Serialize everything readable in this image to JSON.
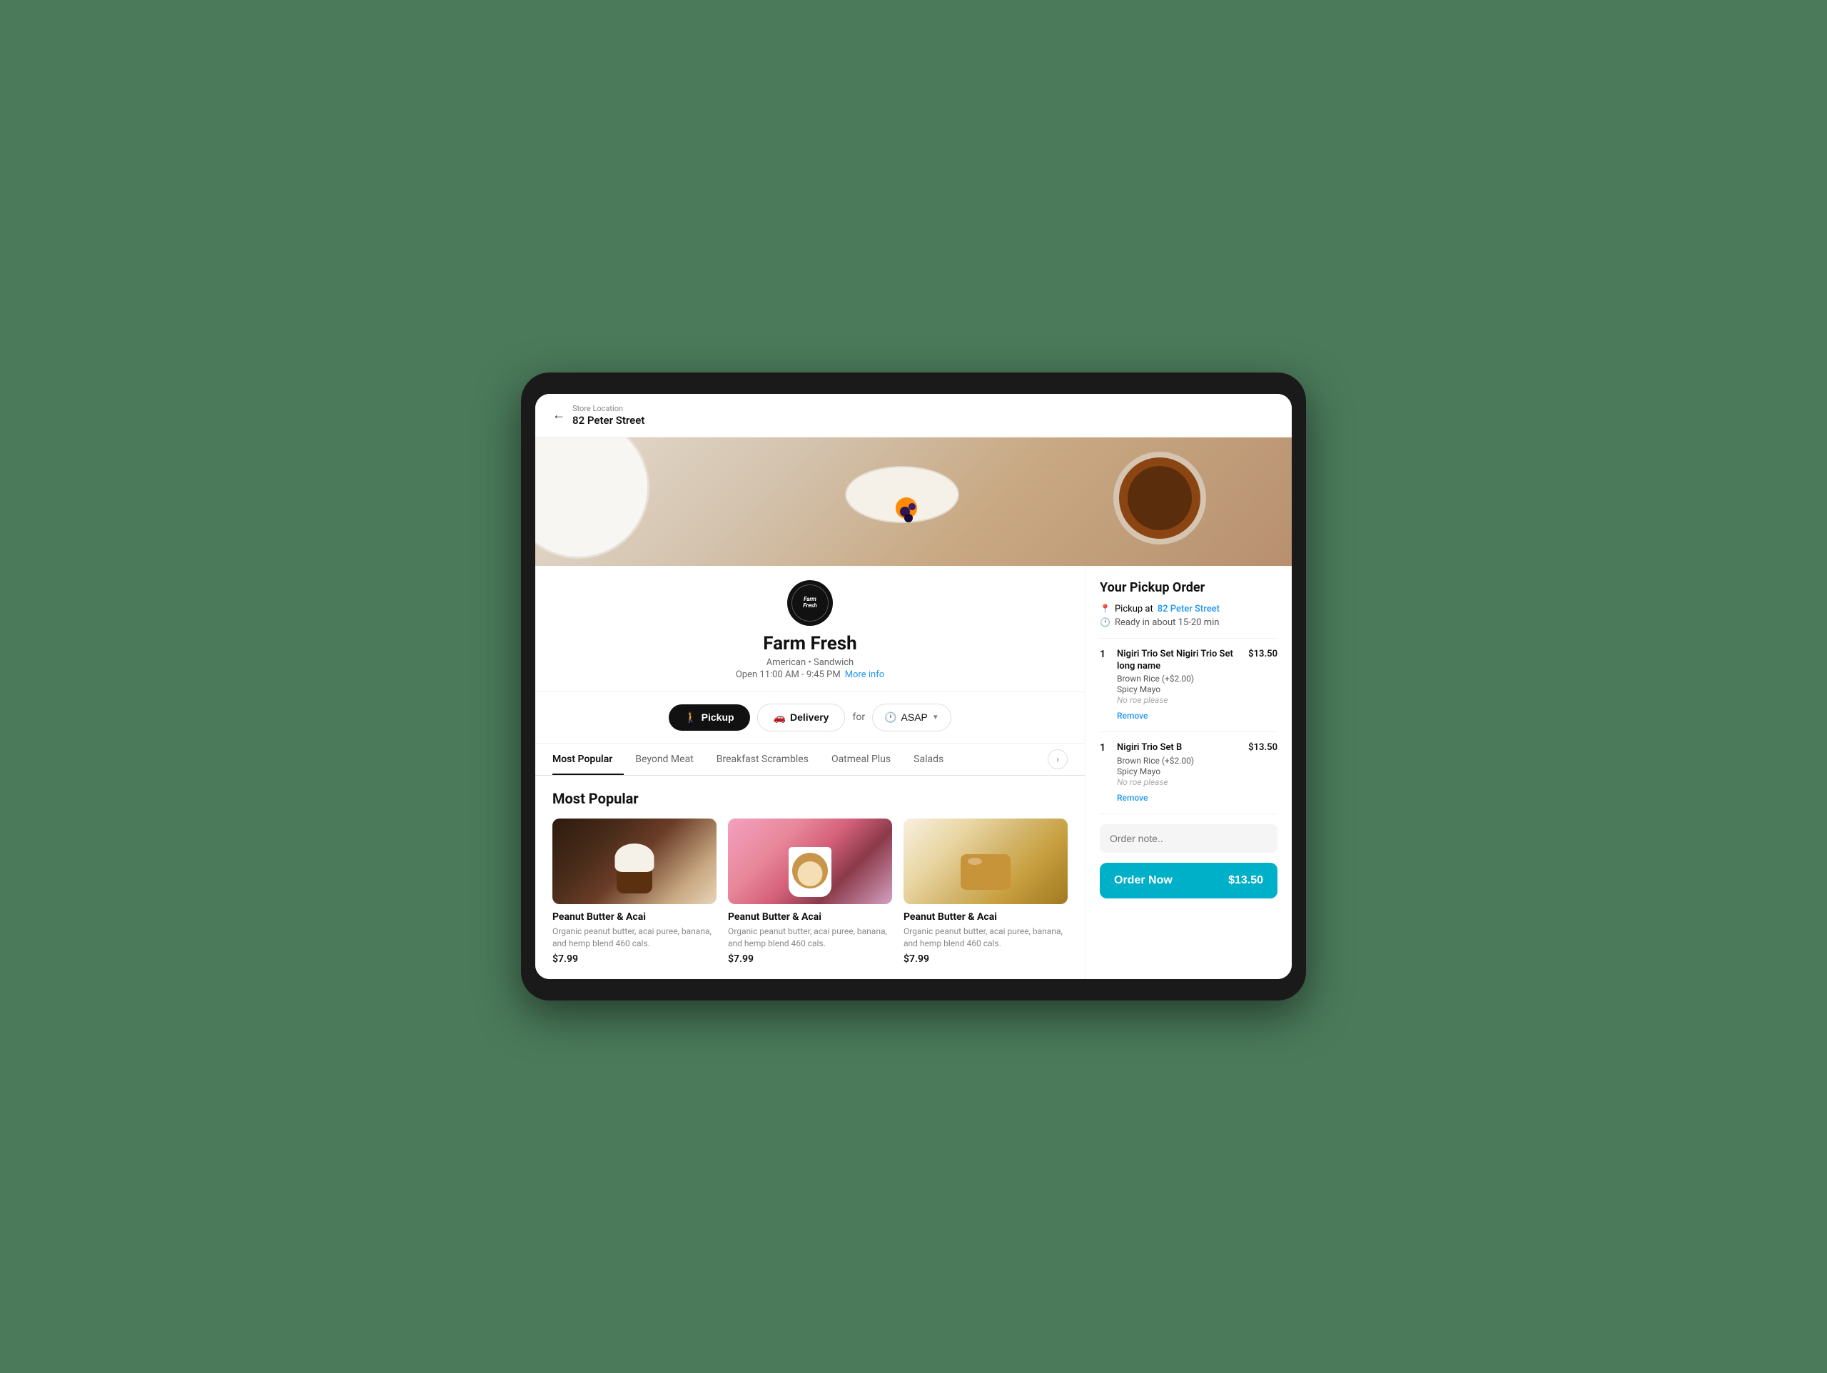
{
  "tablet": {
    "top_bar": {
      "back_label": "←",
      "store_location_label": "Store Location",
      "store_location_name": "82 Peter Street"
    },
    "restaurant": {
      "name": "Farm Fresh",
      "cuisine": "American • Sandwich",
      "hours": "Open 11:00 AM - 9:45 PM",
      "more_info": "More info",
      "logo_text": "Farm\nFresh"
    },
    "actions": {
      "pickup_label": "Pickup",
      "delivery_label": "Delivery",
      "for_label": "for",
      "asap_label": "ASAP"
    },
    "nav_tabs": [
      {
        "label": "Most Popular",
        "active": true
      },
      {
        "label": "Beyond Meat",
        "active": false
      },
      {
        "label": "Breakfast Scrambles",
        "active": false
      },
      {
        "label": "Oatmeal Plus",
        "active": false
      },
      {
        "label": "Salads",
        "active": false
      }
    ],
    "section_title": "Most Popular",
    "menu_items": [
      {
        "name": "Peanut Butter & Acai",
        "description": "Organic peanut butter, acai puree, banana, and hemp blend 460 cals.",
        "price": "$7.99"
      },
      {
        "name": "Peanut Butter & Acai",
        "description": "Organic peanut butter, acai puree, banana, and hemp blend 460 cals.",
        "price": "$7.99"
      },
      {
        "name": "Peanut Butter & Acai",
        "description": "Organic peanut butter, acai puree, banana, and hemp blend 460 cals.",
        "price": "$7.99"
      }
    ],
    "pickup_order": {
      "title": "Your Pickup Order",
      "pickup_at_label": "Pickup at",
      "location": "82 Peter Street",
      "ready_label": "Ready in about 15-20 min",
      "items": [
        {
          "qty": "1",
          "name": "Nigiri Trio Set Nigiri Trio Set long name",
          "mods": [
            "Brown Rice (+$2.00)",
            "Spicy Mayo"
          ],
          "note": "No roe please",
          "price": "$13.50"
        },
        {
          "qty": "1",
          "name": "Nigiri Trio Set B",
          "mods": [
            "Brown Rice (+$2.00)",
            "Spicy Mayo"
          ],
          "note": "No roe please",
          "price": "$13.50"
        }
      ],
      "remove_label": "Remove",
      "order_note_placeholder": "Order note..",
      "order_now_label": "Order Now",
      "order_total": "$13.50"
    }
  }
}
